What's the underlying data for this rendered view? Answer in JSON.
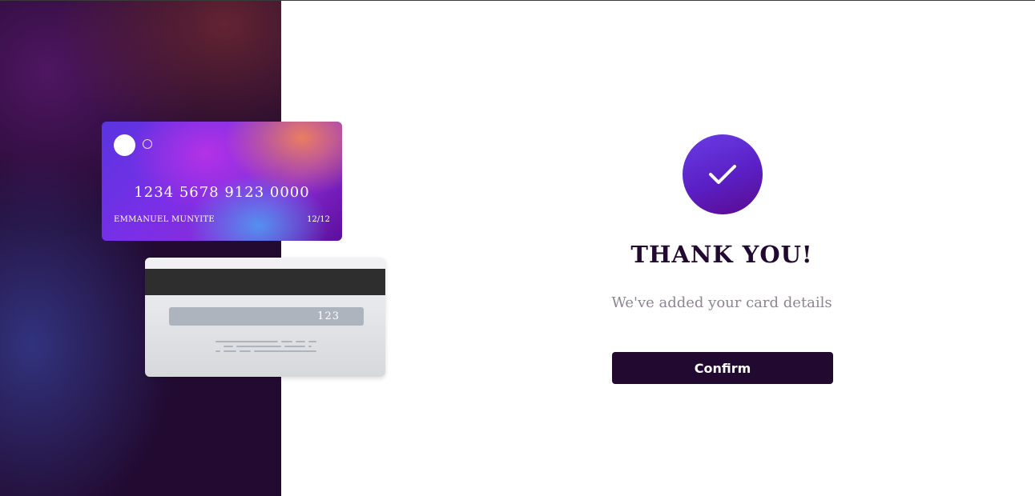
{
  "card_front": {
    "number": "1234 5678 9123 0000",
    "holder": "EMMANUEL MUNYITE",
    "expiry": "12/12",
    "logo_icon": "card-logo-circles"
  },
  "card_back": {
    "cvc": "123"
  },
  "success": {
    "icon": "check-icon",
    "title": "THANK YOU!",
    "message": "We've added your card details",
    "confirm_label": "Confirm"
  },
  "colors": {
    "primary_dark": "#21092f",
    "accent_gradient_start": "#6a3ce6",
    "accent_gradient_end": "#5c0a8e",
    "muted_text": "#8e8593"
  }
}
